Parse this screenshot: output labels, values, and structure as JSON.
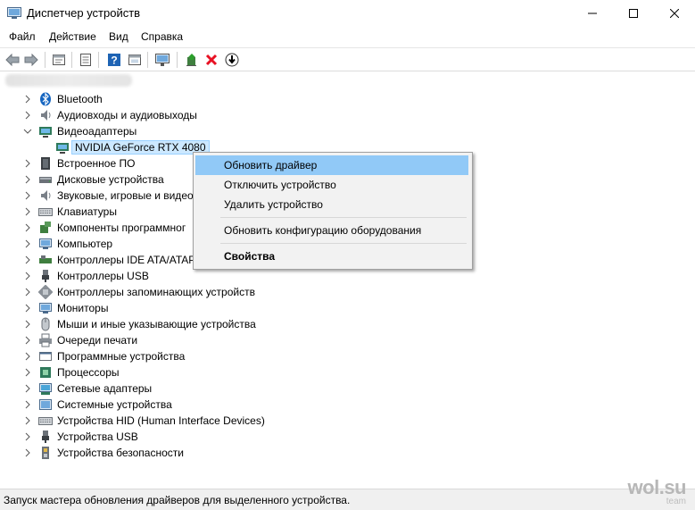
{
  "window": {
    "title": "Диспетчер устройств"
  },
  "menu": [
    "Файл",
    "Действие",
    "Вид",
    "Справка"
  ],
  "toolbar": {
    "icons": [
      "back-arrow-icon",
      "forward-arrow-icon",
      "properties-icon",
      "list-view-icon",
      "help-icon",
      "details-icon",
      "monitor-scan-icon",
      "update-driver-icon",
      "remove-device-icon",
      "download-driver-icon"
    ]
  },
  "tree": {
    "items": [
      {
        "label": "Bluetooth"
      },
      {
        "label": "Аудиовходы и аудиовыходы"
      },
      {
        "label": "Видеоадаптеры",
        "child": "NVIDIA GeForce RTX 4080"
      },
      {
        "label": "Встроенное ПО"
      },
      {
        "label": "Дисковые устройства"
      },
      {
        "label": "Звуковые, игровые и видео"
      },
      {
        "label": "Клавиатуры"
      },
      {
        "label": "Компоненты программног"
      },
      {
        "label": "Компьютер"
      },
      {
        "label": "Контроллеры IDE ATA/ATAP"
      },
      {
        "label": "Контроллеры USB"
      },
      {
        "label": "Контроллеры запоминающих устройств"
      },
      {
        "label": "Мониторы"
      },
      {
        "label": "Мыши и иные указывающие устройства"
      },
      {
        "label": "Очереди печати"
      },
      {
        "label": "Программные устройства"
      },
      {
        "label": "Процессоры"
      },
      {
        "label": "Сетевые адаптеры"
      },
      {
        "label": "Системные устройства"
      },
      {
        "label": "Устройства HID (Human Interface Devices)"
      },
      {
        "label": "Устройства USB"
      },
      {
        "label": "Устройства безопасности"
      }
    ]
  },
  "context_menu": {
    "update_driver": "Обновить драйвер",
    "disable_device": "Отключить устройство",
    "uninstall_device": "Удалить устройство",
    "scan_hardware": "Обновить конфигурацию оборудования",
    "properties": "Свойства"
  },
  "status": {
    "text": "Запуск мастера обновления драйверов для выделенного устройства."
  },
  "watermark": {
    "main": "wol.su",
    "sub": "team"
  },
  "colors": {
    "selection": "#cce8ff",
    "menu_highlight": "#91c9f7",
    "close_red": "#e81123",
    "help_blue": "#1e63b4"
  }
}
